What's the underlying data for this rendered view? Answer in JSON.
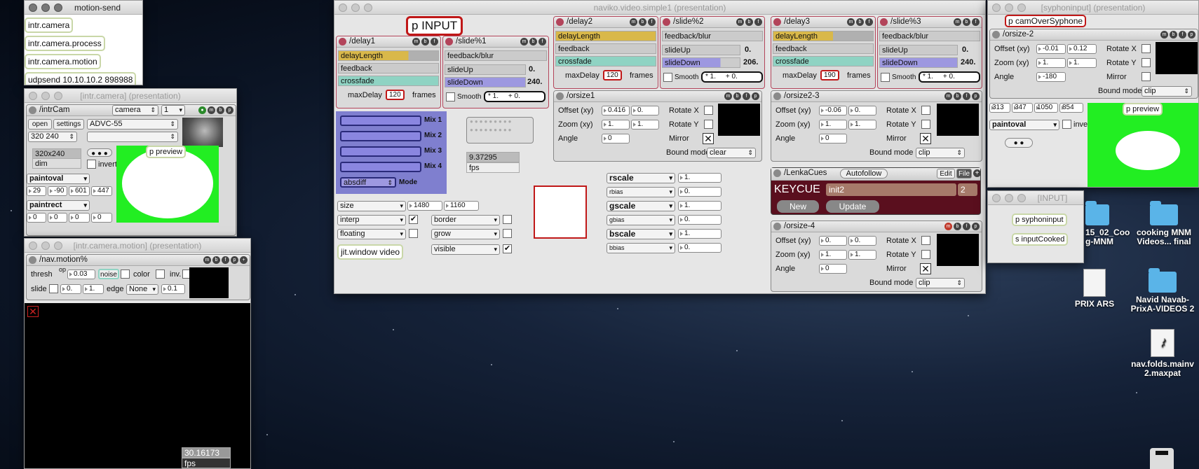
{
  "motion_send": {
    "title": "motion-send",
    "objects": [
      "intr.camera",
      "intr.camera.process",
      "intr.camera.motion",
      "udpsend 10.10.10.2 898988"
    ]
  },
  "intr_camera": {
    "title": "[intr.camera] (presentation)",
    "bp_title": "/intrCam",
    "source": "camera",
    "index": "1",
    "open": "open",
    "settings": "settings",
    "device": "ADVC-55",
    "res": "320 240",
    "res_label": "320x240",
    "dim": "dim",
    "preview": "p preview",
    "invert": "invert",
    "paintoval": "paintoval",
    "oval_vals": [
      "29",
      "-90",
      "601",
      "447"
    ],
    "paintrect": "paintrect",
    "rect_vals": [
      "0",
      "0",
      "0",
      "0"
    ]
  },
  "intr_motion": {
    "title": "[intr.camera.motion] (presentation)",
    "bp_title": "/nav.motion%",
    "thresh": "thresh",
    "op": "op",
    "thresh_val": "0.03",
    "noise": "noise",
    "color": "color",
    "inv": "inv.",
    "slide": "slide",
    "slide_a": "0.",
    "slide_b": "1.",
    "edge": "edge",
    "edge_val": "None",
    "edge_num": "0.1",
    "fps_val": "30.16173",
    "fps": "fps"
  },
  "main": {
    "title": "naviko.video.simple1 (presentation)",
    "pinput": "p INPUT",
    "delay1": {
      "title": "/delay1",
      "delayLength": "delayLength",
      "feedback": "feedback",
      "crossfade": "crossfade",
      "maxDelay": "maxDelay",
      "max": "120",
      "frames": "frames"
    },
    "slide1": {
      "title": "/slide%1",
      "blur": "feedback/blur",
      "up": "slideUp",
      "up_val": "0.",
      "down": "slideDown",
      "down_val": "240.",
      "smooth": "Smooth",
      "expr": "* 1.     + 0."
    },
    "delay2": {
      "title": "/delay2",
      "max": "120"
    },
    "slide2": {
      "title": "/slide%2",
      "up_val": "0.",
      "down_val": "206."
    },
    "delay3": {
      "title": "/delay3",
      "max": "190"
    },
    "slide3": {
      "title": "/slide%3",
      "up_val": "0.",
      "down_val": "240."
    },
    "mix": [
      "Mix 1",
      "Mix 2",
      "Mix 3",
      "Mix 4"
    ],
    "mode_val": "absdiff",
    "mode": "Mode",
    "fps_val": "9.37295",
    "fps": "fps",
    "size": "size",
    "size_a": "1480",
    "size_b": "1160",
    "interp": "interp",
    "border": "border",
    "floating": "floating",
    "grow": "grow",
    "visible": "visible",
    "jitwin": "jit.window video",
    "orsize1": {
      "title": "/orsize1",
      "offset": "Offset (xy)",
      "ox": "0.416",
      "oy": "0.",
      "zoom": "Zoom (xy)",
      "zx": "1.",
      "zy": "1.",
      "angle": "Angle",
      "ang": "0",
      "rx": "Rotate X",
      "ry": "Rotate Y",
      "mirror": "Mirror",
      "bound": "Bound mode",
      "bound_val": "clear"
    },
    "orsize23": {
      "title": "/orsize2-3",
      "ox": "-0.06",
      "oy": "0.",
      "zx": "1.",
      "zy": "1.",
      "ang": "0",
      "bound_val": "clip"
    },
    "scale": {
      "rscale": "rscale",
      "rval": "1.",
      "rbias": "rbias",
      "rbval": "0.",
      "gscale": "gscale",
      "gval": "1.",
      "gbias": "gbias",
      "gbval": "0.",
      "bscale": "bscale",
      "bval": "1.",
      "bbias": "bbias",
      "bbval": "0."
    },
    "cues": {
      "title": "/LenkaCues",
      "autofollow": "Autofollow",
      "edit": "Edit",
      "file": "File",
      "keycue": "KEYCUE",
      "cue": "init2",
      "num": "2",
      "new": "New",
      "update": "Update"
    },
    "orsize4": {
      "title": "/orsize-4",
      "ox": "0.",
      "oy": "0.",
      "zx": "1.",
      "zy": "1.",
      "ang": "0",
      "bound_val": "clip"
    }
  },
  "syphon": {
    "title": "[syphoninput] (presentation)",
    "obj": "p camOverSyphone",
    "bp_title": "/orsize-2",
    "ox": "-0.01",
    "oy": "0.12",
    "zx": "1.",
    "zy": "1.",
    "ang": "-180",
    "bound_val": "clip",
    "nums": [
      "313",
      "347",
      "1050",
      "854"
    ],
    "paintoval": "paintoval",
    "invert": "invert",
    "preview": "p preview"
  },
  "input_win": {
    "title": "[INPUT]",
    "obj1": "p syphoninput",
    "obj2": "s inputCooked"
  },
  "desktop": [
    {
      "label": "15_02_Coo\ng-MNM"
    },
    {
      "label": "cooking MNM\nVideos... final"
    },
    {
      "label": "PRIX ARS"
    },
    {
      "label": "Navid Navab-\nPrixA-VIDEOS 2"
    },
    {
      "label": "nav.folds.mainv\n2.maxpat"
    }
  ]
}
